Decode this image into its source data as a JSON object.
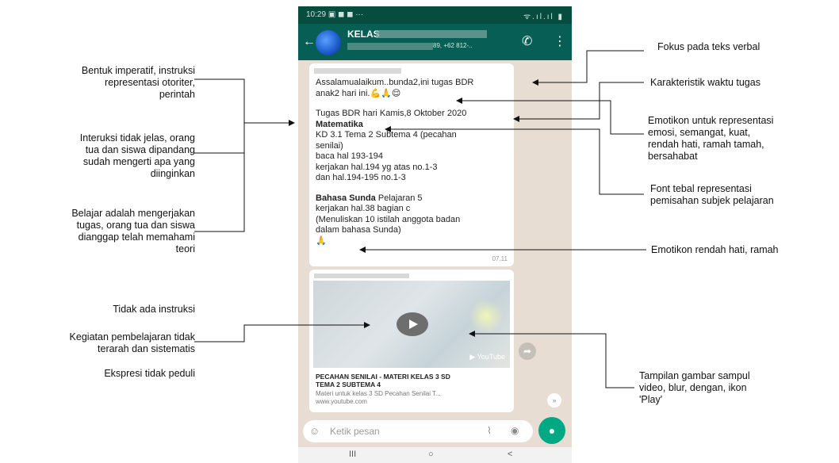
{
  "left_annotations": [
    "Bentuk imperatif, instruksi\nrepresentasi otoriter,\nperintah",
    "Interuksi tidak jelas, orang\ntua dan siswa dipandang\nsudah mengerti apa yang\ndiinginkan",
    "Belajar adalah mengerjakan\ntugas, orang tua dan siswa\ndianggap telah memahami\nteori",
    "Tidak ada instruksi",
    "Kegiatan pembelajaran tidak\nterarah dan sistematis",
    "Ekspresi tidak peduli"
  ],
  "right_annotations": [
    "Fokus pada teks verbal",
    "Karakteristik waktu tugas",
    "Emotikon untuk representasi\nemosi, semangat, kuat,\nrendah hati, ramah tamah,\nbersahabat",
    "Font tebal representasi\npemisahan subjek pelajaran",
    "Emotikon rendah hati, ramah",
    "Tampilan gambar sampul\nvideo, blur, dengan, ikon\n'Play'"
  ],
  "phone": {
    "status_time": "10:29",
    "status_icons": "▣ ◼ ◼ ···",
    "status_right": "ᯤ.ıl.ıl ▮",
    "chat_title": "KELAS",
    "chat_subtitle": "89, +62 812-..",
    "message": {
      "line1": "Assalamualaikum..bunda2,ini tugas BDR",
      "line2": "anak2 hari ini.💪🙏😌",
      "line3": "Tugas BDR hari Kamis,8 Oktober 2020",
      "subject1": "Matematika",
      "m1": " KD 3.1 Tema 2 Subtema 4 (pecahan",
      "m2": "senilai)",
      "m3": "baca hal 193-194",
      "m4": "kerjakan hal.194 yg atas no.1-3",
      "m5": " dan hal.194-195 no.1-3",
      "subject2": "Bahasa Sunda",
      "subject2_rest": " Pelajaran 5",
      "s1": "kerjakan hal.38 bagian c",
      "s2": "(Menuliskan 10 istilah anggota badan",
      "s3": "dalam bahasa Sunda)",
      "emoji": "🙏",
      "time": "07.11"
    },
    "video": {
      "badge": "▶ YouTube",
      "title": "PECAHAN SENILAI - MATERI KELAS 3 SD\nTEMA 2 SUBTEMA 4",
      "desc": "Materi untuk kelas 3 SD Pecahan Senilai T...",
      "url": "www.youtube.com"
    },
    "input_placeholder": "Ketik pesan",
    "nav_recent": "III",
    "nav_home": "○",
    "nav_back": "<"
  }
}
